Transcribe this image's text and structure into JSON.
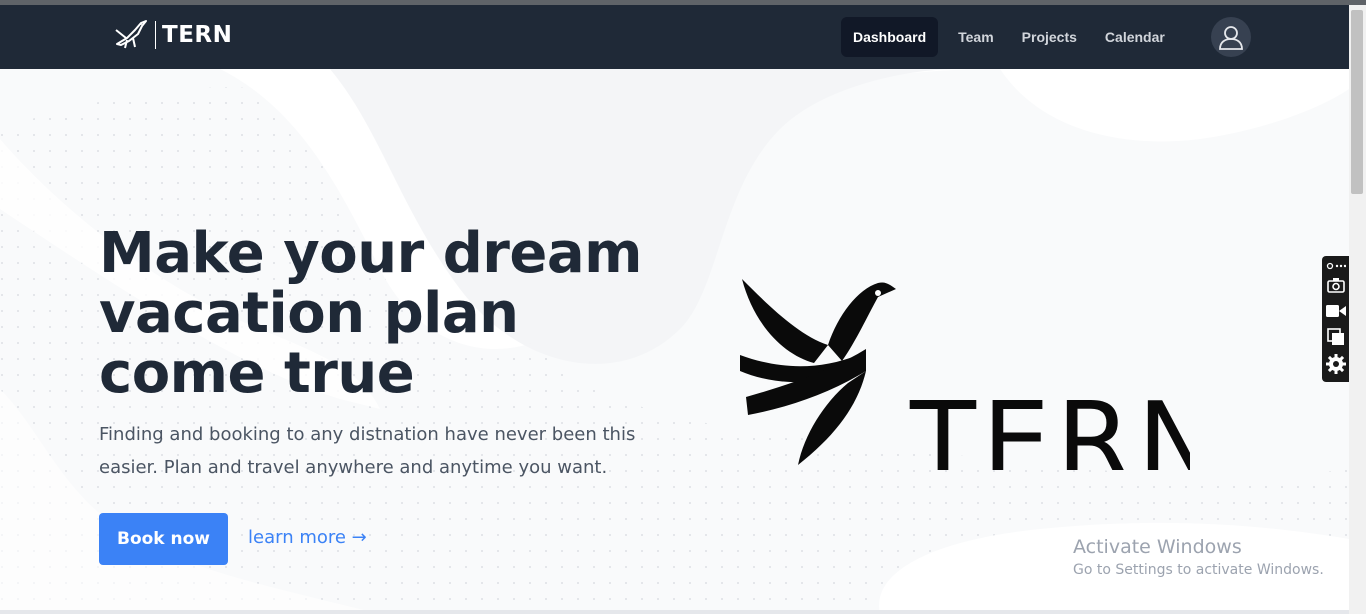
{
  "brand": {
    "name": "TERN",
    "logo_icon": "bird-logo-icon"
  },
  "nav": {
    "links": [
      {
        "label": "Dashboard",
        "active": true
      },
      {
        "label": "Team",
        "active": false
      },
      {
        "label": "Projects",
        "active": false
      },
      {
        "label": "Calendar",
        "active": false
      }
    ],
    "avatar_icon": "user-avatar-icon"
  },
  "hero": {
    "headline": "Make your dream vacation plan come true",
    "subtext": "Finding and booking to any distnation have never been this easier. Plan and travel anywhere and anytime you want.",
    "primary_button": "Book now",
    "secondary_link": "learn more →",
    "logo_text": "TERN"
  },
  "watermark": {
    "title": "Activate Windows",
    "subtitle": "Go to Settings to activate Windows."
  },
  "toolbar": {
    "icons": [
      "link-menu-icon",
      "camera-icon",
      "video-icon",
      "layers-icon",
      "gear-icon"
    ]
  },
  "colors": {
    "navbar": "#1f2937",
    "accent": "#3b82f6",
    "headline": "#1f2937"
  }
}
